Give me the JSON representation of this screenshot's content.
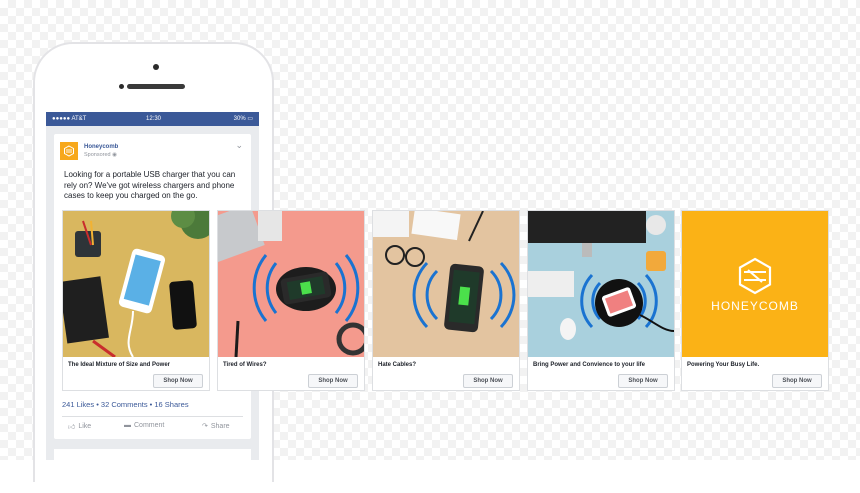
{
  "status_bar": {
    "carrier": "●●●●● AT&T",
    "time": "12:30",
    "battery": "30% ▭"
  },
  "post": {
    "page_name": "Honeycomb",
    "sponsored": "Sponsored",
    "text": "Looking for a portable USB charger that you can rely on? We've got wireless chargers and phone cases to keep you charged on the go.",
    "engagement": "241 Likes • 32 Comments • 16 Shares",
    "actions": {
      "like": "Like",
      "comment": "Comment",
      "share": "Share"
    }
  },
  "cards": [
    {
      "caption": "The Ideal Mixture of Size and Power",
      "button": "Shop Now",
      "bg": "#d9b75f"
    },
    {
      "caption": "Tired of Wires?",
      "button": "Shop Now",
      "bg": "#f49a8d"
    },
    {
      "caption": "Hate Cables?",
      "button": "Shop Now",
      "bg": "#e3c4a0"
    },
    {
      "caption": "Bring Power and Convience to your life",
      "button": "Shop Now",
      "bg": "#a9d0dd"
    },
    {
      "caption": "Powering Your Busy Life.",
      "button": "Shop Now",
      "bg": "#fbb216"
    }
  ],
  "brand": {
    "wordmark": "HONEYCOMB",
    "accent": "#f7a81b",
    "facebook_blue": "#3b5998"
  }
}
